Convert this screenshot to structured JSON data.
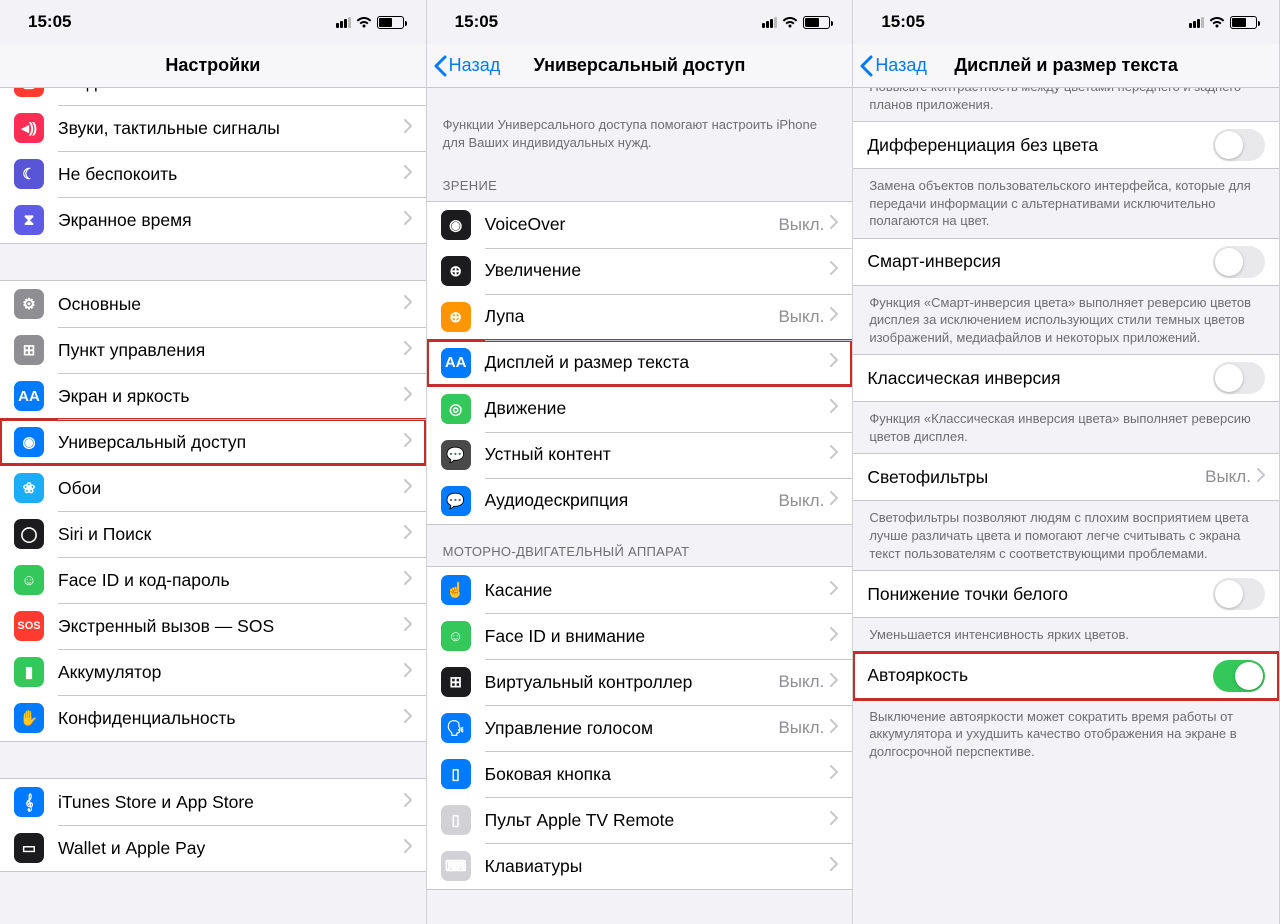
{
  "status": {
    "time": "15:05",
    "battery_pct": 55
  },
  "pane1": {
    "title": "Настройки",
    "groups": [
      {
        "rows": [
          {
            "icon": "notif-icon",
            "color": "ic-red",
            "glyph": "▢",
            "label": "Уведомления"
          },
          {
            "icon": "sounds-icon",
            "color": "ic-pink",
            "glyph": "◂⸩",
            "label": "Звуки, тактильные сигналы"
          },
          {
            "icon": "dnd-icon",
            "color": "ic-purple",
            "glyph": "☾",
            "label": "Не беспокоить"
          },
          {
            "icon": "screentime-icon",
            "color": "ic-indigo",
            "glyph": "⧗",
            "label": "Экранное время"
          }
        ]
      },
      {
        "rows": [
          {
            "icon": "general-icon",
            "color": "ic-gray",
            "glyph": "⚙",
            "label": "Основные"
          },
          {
            "icon": "control-icon",
            "color": "ic-gray",
            "glyph": "⊞",
            "label": "Пункт управления"
          },
          {
            "icon": "display-icon",
            "color": "ic-blue",
            "glyph": "AA",
            "label": "Экран и яркость"
          },
          {
            "icon": "accessibility-icon",
            "color": "ic-blue",
            "glyph": "◉",
            "label": "Универсальный доступ",
            "highlight": true
          },
          {
            "icon": "wallpaper-icon",
            "color": "ic-cyan",
            "glyph": "❀",
            "label": "Обои"
          },
          {
            "icon": "siri-icon",
            "color": "ic-black",
            "glyph": "◯",
            "label": "Siri и Поиск"
          },
          {
            "icon": "faceid-icon",
            "color": "ic-green",
            "glyph": "☺",
            "label": "Face ID и код-пароль"
          },
          {
            "icon": "sos-icon",
            "color": "ic-red",
            "glyph": "SOS",
            "label": "Экстренный вызов — SOS"
          },
          {
            "icon": "battery-icon",
            "color": "ic-green",
            "glyph": "▮",
            "label": "Аккумулятор"
          },
          {
            "icon": "privacy-icon",
            "color": "ic-blue",
            "glyph": "✋",
            "label": "Конфиденциальность"
          }
        ]
      },
      {
        "rows": [
          {
            "icon": "itunes-icon",
            "color": "ic-blue",
            "glyph": "𝄞",
            "label": "iTunes Store и App Store"
          },
          {
            "icon": "wallet-icon",
            "color": "ic-black",
            "glyph": "▭",
            "label": "Wallet и Apple Pay"
          }
        ]
      }
    ]
  },
  "pane2": {
    "back": "Назад",
    "title": "Универсальный доступ",
    "intro": "Функции Универсального доступа помогают настроить iPhone для Ваших индивидуальных нужд.",
    "headers": {
      "vision": "ЗРЕНИЕ",
      "motor": "МОТОРНО-ДВИГАТЕЛЬНЫЙ АППАРАТ"
    },
    "vision": [
      {
        "icon": "voiceover-icon",
        "color": "ic-black",
        "glyph": "◉",
        "label": "VoiceOver",
        "value": "Выкл."
      },
      {
        "icon": "zoom-icon",
        "color": "ic-black",
        "glyph": "⊕",
        "label": "Увеличение"
      },
      {
        "icon": "magnifier-icon",
        "color": "ic-orange",
        "glyph": "⊕",
        "label": "Лупа",
        "value": "Выкл."
      },
      {
        "icon": "textsize-icon",
        "color": "ic-blue",
        "glyph": "AA",
        "label": "Дисплей и размер текста",
        "highlight": true
      },
      {
        "icon": "motion-icon",
        "color": "ic-green",
        "glyph": "◎",
        "label": "Движение"
      },
      {
        "icon": "spoken-icon",
        "color": "ic-darkgray",
        "glyph": "💬",
        "label": "Устный контент"
      },
      {
        "icon": "audiodesc-icon",
        "color": "ic-blue",
        "glyph": "💬",
        "label": "Аудиодескрипция",
        "value": "Выкл."
      }
    ],
    "motor": [
      {
        "icon": "touch-icon",
        "color": "ic-blue",
        "glyph": "☝",
        "label": "Касание"
      },
      {
        "icon": "faceid-att-icon",
        "color": "ic-green",
        "glyph": "☺",
        "label": "Face ID и внимание"
      },
      {
        "icon": "switch-icon",
        "color": "ic-black",
        "glyph": "⊞",
        "label": "Виртуальный контроллер",
        "value": "Выкл."
      },
      {
        "icon": "voicecontrol-icon",
        "color": "ic-blue",
        "glyph": "🗣",
        "label": "Управление голосом",
        "value": "Выкл."
      },
      {
        "icon": "sidebutton-icon",
        "color": "ic-blue",
        "glyph": "▯",
        "label": "Боковая кнопка"
      },
      {
        "icon": "remote-icon",
        "color": "ic-lightgray",
        "glyph": "▯",
        "label": "Пульт Apple TV Remote"
      },
      {
        "icon": "keyboard-icon",
        "color": "ic-lightgray",
        "glyph": "⌨",
        "label": "Клавиатуры"
      }
    ]
  },
  "pane3": {
    "back": "Назад",
    "title": "Дисплей и размер текста",
    "items": [
      {
        "type": "footer",
        "text": "Повысьте контрастность между цветами переднего и заднего планов приложения.",
        "cut": true
      },
      {
        "type": "toggle",
        "label": "Дифференциация без цвета",
        "on": false
      },
      {
        "type": "footer",
        "text": "Замена объектов пользовательского интерфейса, которые для передачи информации с альтернативами исключительно полагаются на цвет."
      },
      {
        "type": "toggle",
        "label": "Смарт-инверсия",
        "on": false
      },
      {
        "type": "footer",
        "text": "Функция «Смарт-инверсия цвета» выполняет реверсию цветов дисплея за исключением использующих стили темных цветов изображений, медиафайлов и некоторых приложений."
      },
      {
        "type": "toggle",
        "label": "Классическая инверсия",
        "on": false
      },
      {
        "type": "footer",
        "text": "Функция «Классическая инверсия цвета» выполняет реверсию цветов дисплея."
      },
      {
        "type": "link",
        "label": "Светофильтры",
        "value": "Выкл."
      },
      {
        "type": "footer",
        "text": "Светофильтры позволяют людям с плохим восприятием цвета лучше различать цвета и помогают легче считывать с экрана текст пользователям с соответствующими проблемами."
      },
      {
        "type": "toggle",
        "label": "Понижение точки белого",
        "on": false
      },
      {
        "type": "footer",
        "text": "Уменьшается интенсивность ярких цветов."
      },
      {
        "type": "toggle",
        "label": "Автояркость",
        "on": true,
        "highlight": true
      },
      {
        "type": "footer",
        "text": "Выключение автояркости может сократить время работы от аккумулятора и ухудшить качество отображения на экране в долгосрочной перспективе."
      }
    ]
  }
}
